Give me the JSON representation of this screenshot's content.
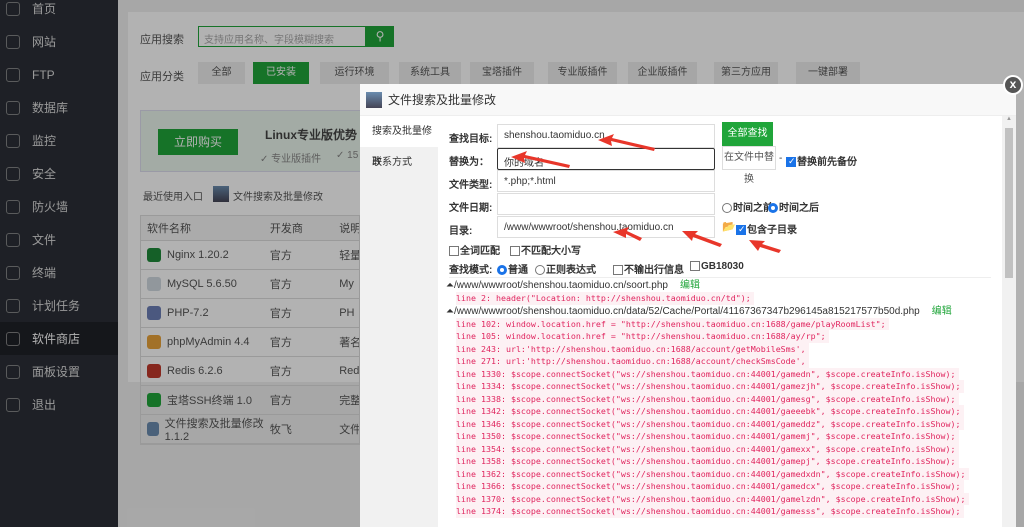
{
  "sidebar": {
    "items": [
      {
        "label": "首页"
      },
      {
        "label": "网站"
      },
      {
        "label": "FTP"
      },
      {
        "label": "数据库"
      },
      {
        "label": "监控"
      },
      {
        "label": "安全"
      },
      {
        "label": "防火墙"
      },
      {
        "label": "文件"
      },
      {
        "label": "终端"
      },
      {
        "label": "计划任务"
      },
      {
        "label": "软件商店"
      },
      {
        "label": "面板设置"
      },
      {
        "label": "退出"
      }
    ],
    "active": "软件商店"
  },
  "store": {
    "search_label": "应用搜索",
    "search_placeholder": "支持应用名称、字段模糊搜索",
    "category_label": "应用分类",
    "categories": [
      "全部",
      "已安装",
      "运行环境",
      "系统工具",
      "宝塔插件",
      "专业版插件",
      "企业版插件",
      "第三方应用",
      "一键部署"
    ],
    "buy_button": "立即购买",
    "pro_title": "Linux专业版优势",
    "pro_feature1": "✓ 专业版插件",
    "pro_feature2": "✓ 15",
    "recent_label": "最近使用入口",
    "recent_item": "文件搜索及批量修改",
    "table_headers": [
      "软件名称",
      "开发商",
      "说明"
    ],
    "rows": [
      {
        "name": "Nginx 1.20.2",
        "dev": "官方",
        "desc": "轻量"
      },
      {
        "name": "MySQL 5.6.50",
        "dev": "官方",
        "desc": "My"
      },
      {
        "name": "PHP-7.2",
        "dev": "官方",
        "desc": "PH"
      },
      {
        "name": "phpMyAdmin 4.4",
        "dev": "官方",
        "desc": "著名"
      },
      {
        "name": "Redis 6.2.6",
        "dev": "官方",
        "desc": "Red"
      },
      {
        "name": "宝塔SSH终端 1.0",
        "dev": "官方",
        "desc": "完整"
      },
      {
        "name": "文件搜索及批量修改 1.1.2",
        "dev": "牧飞",
        "desc": "文件"
      }
    ]
  },
  "modal": {
    "title": "文件搜索及批量修改",
    "close": "x",
    "tabs": [
      "搜索及批量修改",
      "联系方式"
    ],
    "form": {
      "target_label": "查找目标:",
      "target_value": "shenshou.taomiduo.cn",
      "find_all": "全部查找",
      "replace_label": "替换为：",
      "replace_value": "你的域名",
      "replace_button": "在文件中替换",
      "dash": "-",
      "backup_label": "替换前先备份",
      "type_label": "文件类型:",
      "type_value": "*.php;*.html",
      "date_label": "文件日期:",
      "date_value": "",
      "before_label": "时间之前",
      "after_label": "时间之后",
      "dir_label": "目录:",
      "dir_value": "/www/wwwroot/shenshou.taomiduo.cn",
      "subdir_label": "包含子目录",
      "whole_word": "全词匹配",
      "ignore_case": "不匹配大小写",
      "mode_label": "查找模式:",
      "mode_normal": "普通",
      "mode_regex": "正则表达式",
      "no_line_info": "不输出行信息",
      "gb18030": "GB18030"
    },
    "results": [
      {
        "path": "/www/wwwroot/shenshou.taomiduo.cn/soort.php",
        "edit": "编辑",
        "lines": [
          "line 2: header(\"Location: http://shenshou.taomiduo.cn/td\");"
        ]
      },
      {
        "path": "/www/wwwroot/shenshou.taomiduo.cn/data/52/Cache/Portal/41167367347b296145a815217577b50d.php",
        "edit": "编辑",
        "lines": [
          "line 102: window.location.href = \"http://shenshou.taomiduo.cn:1688/game/playRoomList\";",
          "line 105: window.location.href = \"http://shenshou.taomiduo.cn:1688/ay/rp\";",
          "line 243: url:'http://shenshou.taomiduo.cn:1688/account/getMobileSms',",
          "line 271: url:'http://shenshou.taomiduo.cn:1688/account/checkSmsCode',",
          "line 1330: $scope.connectSocket(\"ws://shenshou.taomiduo.cn:44001/gamedn\", $scope.createInfo.isShow);",
          "line 1334: $scope.connectSocket(\"ws://shenshou.taomiduo.cn:44001/gamezjh\", $scope.createInfo.isShow);",
          "line 1338: $scope.connectSocket(\"ws://shenshou.taomiduo.cn:44001/gamesg\", $scope.createInfo.isShow);",
          "line 1342: $scope.connectSocket(\"ws://shenshou.taomiduo.cn:44001/gaeeebk\", $scope.createInfo.isShow);",
          "line 1346: $scope.connectSocket(\"ws://shenshou.taomiduo.cn:44001/gameddz\", $scope.createInfo.isShow);",
          "line 1350: $scope.connectSocket(\"ws://shenshou.taomiduo.cn:44001/gamemj\", $scope.createInfo.isShow);",
          "line 1354: $scope.connectSocket(\"ws://shenshou.taomiduo.cn:44001/gamexx\", $scope.createInfo.isShow);",
          "line 1358: $scope.connectSocket(\"ws://shenshou.taomiduo.cn:44001/gamepj\", $scope.createInfo.isShow);",
          "line 1362: $scope.connectSocket(\"ws://shenshou.taomiduo.cn:44001/gamedxdn\", $scope.createInfo.isShow);",
          "line 1366: $scope.connectSocket(\"ws://shenshou.taomiduo.cn:44001/gamedcx\", $scope.createInfo.isShow);",
          "line 1370: $scope.connectSocket(\"ws://shenshou.taomiduo.cn:44001/gamelzdn\", $scope.createInfo.isShow);",
          "line 1374: $scope.connectSocket(\"ws://shenshou.taomiduo.cn:44001/gamesss\", $scope.createInfo.isShow);"
        ]
      }
    ]
  },
  "colors": {
    "accent": "#20a53a",
    "annotation": "#e8362a",
    "result_text": "#e0245e"
  }
}
